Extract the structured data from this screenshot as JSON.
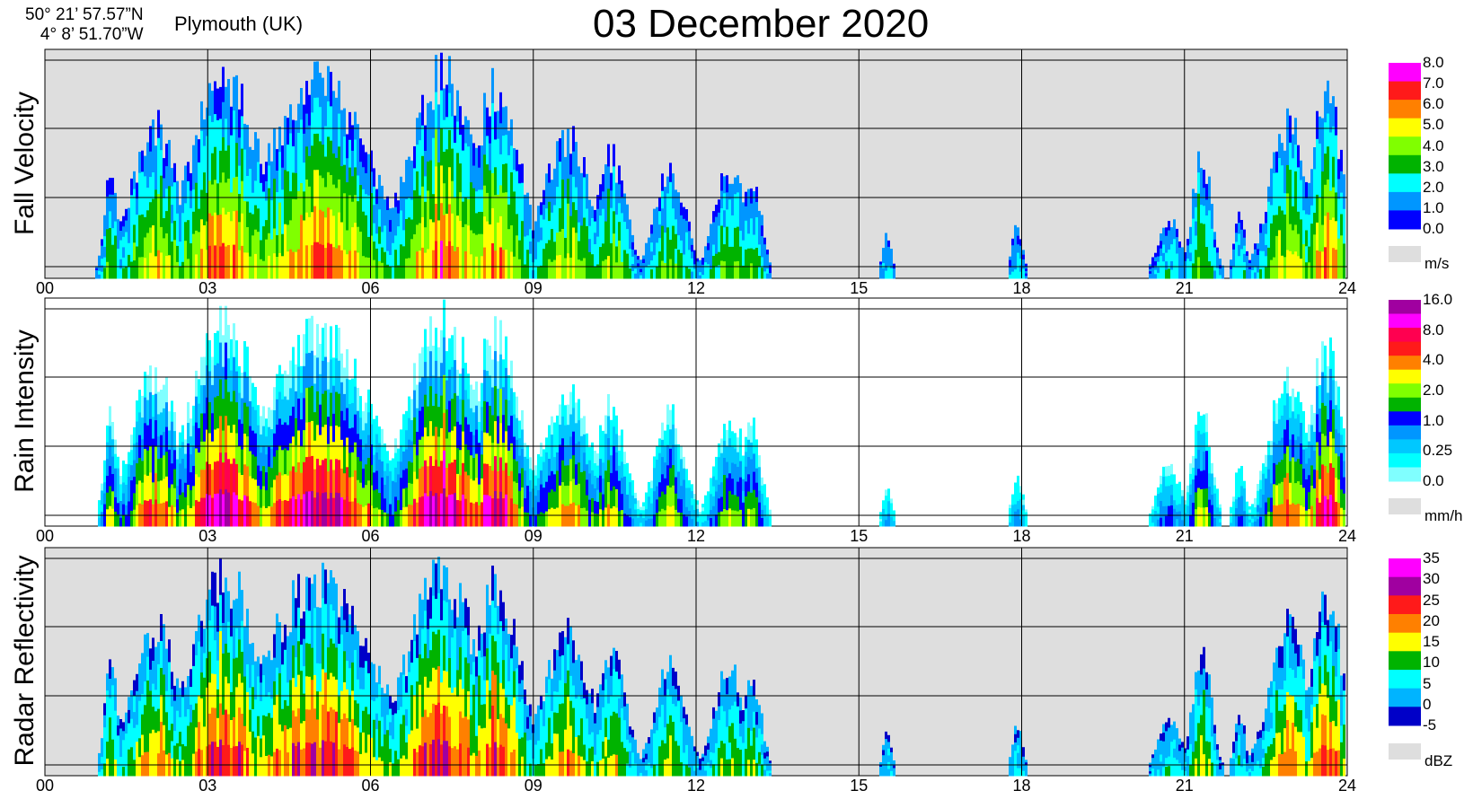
{
  "header": {
    "lat": "50° 21’ 57.57”N",
    "lon": "4°  8’ 51.70”W",
    "location": "Plymouth (UK)",
    "title": "03 December  2020"
  },
  "chart_data": [
    {
      "type": "heatmap",
      "title": "Fall Velocity",
      "ylabel": "Fall Velocity",
      "xlabel": "",
      "x_ticks": [
        "00",
        "03",
        "06",
        "09",
        "12",
        "15",
        "18",
        "21",
        "24"
      ],
      "xlim": [
        0,
        24
      ],
      "unit": "m/s",
      "colorbar": {
        "labels": [
          "8.0",
          "7.0",
          "6.0",
          "5.0",
          "4.0",
          "3.0",
          "2.0",
          "1.0",
          "0.0"
        ],
        "colors": [
          "#ff00ff",
          "#ff1a1a",
          "#ff8000",
          "#ffff00",
          "#80ff00",
          "#00b300",
          "#00ffff",
          "#0096ff",
          "#0000ff"
        ]
      },
      "background": "#dedede"
    },
    {
      "type": "heatmap",
      "title": "Rain Intensity",
      "ylabel": "Rain Intensity",
      "xlabel": "",
      "x_ticks": [
        "00",
        "03",
        "06",
        "09",
        "12",
        "15",
        "18",
        "21",
        "24"
      ],
      "xlim": [
        0,
        24
      ],
      "unit": "mm/h",
      "colorbar": {
        "labels": [
          "16.0",
          "8.0",
          "4.0",
          "2.0",
          "1.0",
          "0.25",
          "0.0"
        ],
        "colors": [
          "#a000a0",
          "#ff00ff",
          "#ff0050",
          "#ff1a1a",
          "#ff8000",
          "#ffff00",
          "#80ff00",
          "#00b300",
          "#0000ff",
          "#0096ff",
          "#00c8ff",
          "#00ffff",
          "#80ffff"
        ]
      },
      "background": "#ffffff"
    },
    {
      "type": "heatmap",
      "title": "Radar Reflectivity",
      "ylabel": "Radar Reflectivity",
      "xlabel": "",
      "x_ticks": [
        "00",
        "03",
        "06",
        "09",
        "12",
        "15",
        "18",
        "21",
        "24"
      ],
      "xlim": [
        0,
        24
      ],
      "unit": "dBZ",
      "colorbar": {
        "labels": [
          "35",
          "30",
          "25",
          "20",
          "15",
          "10",
          "5",
          "0",
          "-5"
        ],
        "colors": [
          "#ff00ff",
          "#a000a0",
          "#ff1a1a",
          "#ff8000",
          "#ffff00",
          "#00b300",
          "#00ffff",
          "#00b4ff",
          "#0000c8"
        ]
      },
      "background": "#dedede"
    }
  ]
}
